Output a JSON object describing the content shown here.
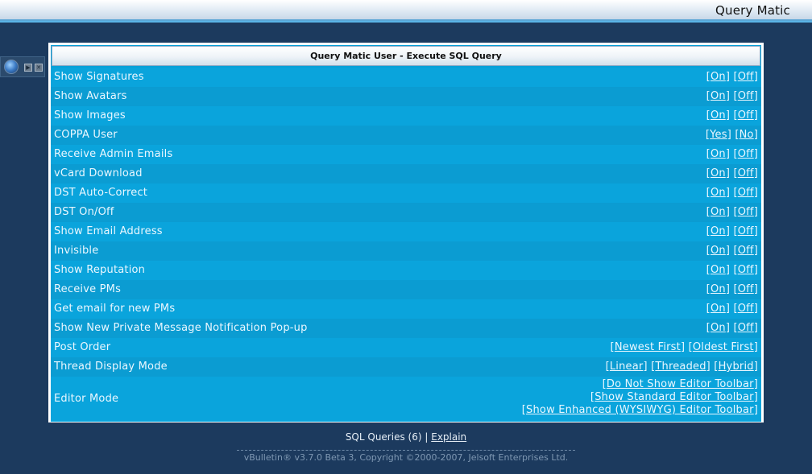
{
  "header": {
    "app_title": "Query Matic"
  },
  "panel": {
    "title": "Query Matic User - Execute SQL Query",
    "rows": [
      {
        "label": "Show Signatures",
        "options": [
          "On",
          "Off"
        ]
      },
      {
        "label": "Show Avatars",
        "options": [
          "On",
          "Off"
        ]
      },
      {
        "label": "Show Images",
        "options": [
          "On",
          "Off"
        ]
      },
      {
        "label": "COPPA User",
        "options": [
          "Yes",
          "No"
        ]
      },
      {
        "label": "Receive Admin Emails",
        "options": [
          "On",
          "Off"
        ]
      },
      {
        "label": "vCard Download",
        "options": [
          "On",
          "Off"
        ]
      },
      {
        "label": "DST Auto-Correct",
        "options": [
          "On",
          "Off"
        ]
      },
      {
        "label": "DST On/Off",
        "options": [
          "On",
          "Off"
        ]
      },
      {
        "label": "Show Email Address",
        "options": [
          "On",
          "Off"
        ]
      },
      {
        "label": "Invisible",
        "options": [
          "On",
          "Off"
        ]
      },
      {
        "label": "Show Reputation",
        "options": [
          "On",
          "Off"
        ]
      },
      {
        "label": "Receive PMs",
        "options": [
          "On",
          "Off"
        ]
      },
      {
        "label": "Get email for new PMs",
        "options": [
          "On",
          "Off"
        ]
      },
      {
        "label": "Show New Private Message Notification Pop-up",
        "options": [
          "On",
          "Off"
        ]
      },
      {
        "label": "Post Order",
        "options": [
          "Newest First",
          "Oldest First"
        ]
      },
      {
        "label": "Thread Display Mode",
        "options": [
          "Linear",
          "Threaded",
          "Hybrid"
        ]
      },
      {
        "label": "Editor Mode",
        "options": [
          "Do Not Show Editor Toolbar",
          "Show Standard Editor Toolbar",
          "Show Enhanced (WYSIWYG) Editor Toolbar"
        ],
        "stacked": true
      }
    ]
  },
  "footer": {
    "sql_queries": "SQL Queries (6)",
    "separator": "|",
    "explain_label": "Explain",
    "copyright": "vBulletin® v3.7.0 Beta 3, Copyright ©2000-2007, Jelsoft Enterprises Ltd."
  }
}
